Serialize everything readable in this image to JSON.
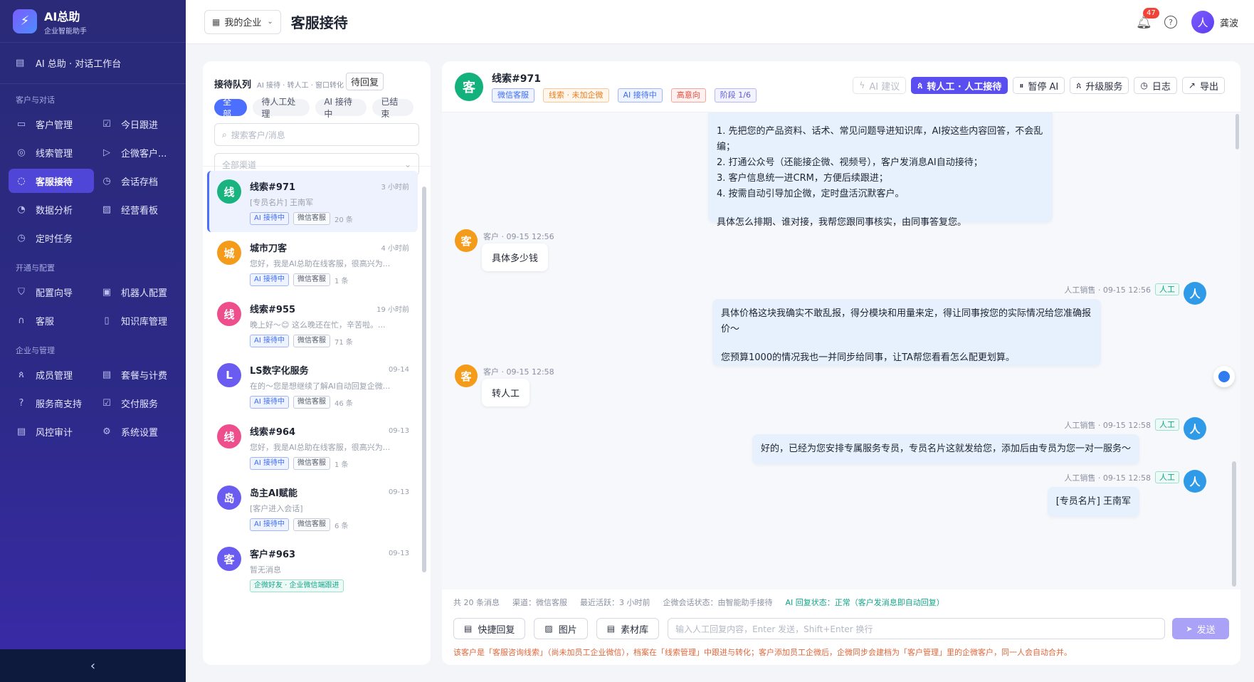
{
  "brand": {
    "name": "AI总助",
    "subtitle": "企业智能助手",
    "logo_icon": "lightning-icon"
  },
  "workbench": {
    "label": "AI 总助 · 对话工作台"
  },
  "nav_sections": [
    {
      "title": "客户与对话",
      "items": [
        {
          "label": "客户管理",
          "icon": "id-card-icon"
        },
        {
          "label": "今日跟进",
          "icon": "checkbox-icon"
        },
        {
          "label": "线索管理",
          "icon": "target-icon"
        },
        {
          "label": "企微客户...",
          "icon": "send-icon"
        },
        {
          "label": "客服接待",
          "icon": "chat-icon",
          "active": true
        },
        {
          "label": "会话存档",
          "icon": "history-icon"
        },
        {
          "label": "数据分析",
          "icon": "gauge-icon"
        },
        {
          "label": "经营看板",
          "icon": "chart-icon"
        },
        {
          "label": "定时任务",
          "icon": "clock-icon"
        }
      ]
    },
    {
      "title": "开通与配置",
      "items": [
        {
          "label": "配置向导",
          "icon": "shield-icon"
        },
        {
          "label": "机器人配置",
          "icon": "robot-icon"
        },
        {
          "label": "客服",
          "icon": "headset-icon"
        },
        {
          "label": "知识库管理",
          "icon": "book-icon"
        }
      ]
    },
    {
      "title": "企业与管理",
      "items": [
        {
          "label": "成员管理",
          "icon": "users-icon"
        },
        {
          "label": "套餐与计费",
          "icon": "package-icon"
        },
        {
          "label": "服务商支持",
          "icon": "help-icon"
        },
        {
          "label": "交付服务",
          "icon": "checkbox-icon"
        },
        {
          "label": "风控审计",
          "icon": "audit-icon"
        },
        {
          "label": "系统设置",
          "icon": "gear-icon"
        }
      ]
    }
  ],
  "topbar": {
    "enterprise": "我的企业",
    "title": "客服接待",
    "notification_count": "47",
    "user_avatar": "人",
    "user_name": "龚波"
  },
  "queue": {
    "title": "接待队列",
    "subtitle": "AI 接待 · 转人工 · 窗口转化",
    "pending_label": "待回复",
    "tabs": [
      "全部",
      "待人工处理",
      "AI 接待中",
      "已结束"
    ],
    "search_placeholder": "搜索客户/消息",
    "channel_placeholder": "全部渠道",
    "items": [
      {
        "avatar": "线",
        "color": "#19b37f",
        "name": "线索#971",
        "time": "3 小时前",
        "preview": "[专员名片] 王南军",
        "tags": [
          {
            "t": "AI 接待中",
            "c": "blue"
          },
          {
            "t": "微信客服",
            "c": "gray"
          }
        ],
        "count": "20 条",
        "active": true
      },
      {
        "avatar": "城",
        "color": "#f49b1a",
        "name": "城市刀客",
        "time": "4 小时前",
        "preview": "您好，我是AI总助在线客服，很高兴为...",
        "tags": [
          {
            "t": "AI 接待中",
            "c": "blue"
          },
          {
            "t": "微信客服",
            "c": "gray"
          }
        ],
        "count": "1 条"
      },
      {
        "avatar": "线",
        "color": "#ee4f8c",
        "name": "线索#955",
        "time": "19 小时前",
        "preview": "晚上好～😊 这么晚还在忙，辛苦啦。...",
        "tags": [
          {
            "t": "AI 接待中",
            "c": "blue"
          },
          {
            "t": "微信客服",
            "c": "gray"
          }
        ],
        "count": "71 条"
      },
      {
        "avatar": "L",
        "color": "#6a5cf0",
        "name": "LS数字化服务",
        "time": "09-14",
        "preview": "在的～您是想继续了解AI自动回复企微...",
        "tags": [
          {
            "t": "AI 接待中",
            "c": "blue"
          },
          {
            "t": "微信客服",
            "c": "gray"
          }
        ],
        "count": "46 条"
      },
      {
        "avatar": "线",
        "color": "#ee4f8c",
        "name": "线索#964",
        "time": "09-13",
        "preview": "您好，我是AI总助在线客服，很高兴为...",
        "tags": [
          {
            "t": "AI 接待中",
            "c": "blue"
          },
          {
            "t": "微信客服",
            "c": "gray"
          }
        ],
        "count": "1 条"
      },
      {
        "avatar": "岛",
        "color": "#6a5cf0",
        "name": "岛主AI赋能",
        "time": "09-13",
        "preview": "[客户进入会话]",
        "tags": [
          {
            "t": "AI 接待中",
            "c": "blue"
          },
          {
            "t": "微信客服",
            "c": "gray"
          }
        ],
        "count": "6 条"
      },
      {
        "avatar": "客",
        "color": "#6a5cf0",
        "name": "客户#963",
        "time": "09-13",
        "preview": "暂无消息",
        "tags": [
          {
            "t": "企微好友 · 企业微信端跟进",
            "c": "green"
          }
        ],
        "count": ""
      }
    ]
  },
  "chat": {
    "avatar": "客",
    "name": "线索#971",
    "tags": [
      {
        "t": "微信客服",
        "c": "blue"
      },
      {
        "t": "线索 · 未加企微",
        "c": "orange"
      },
      {
        "t": "AI 接待中",
        "c": "blue"
      },
      {
        "t": "高意向",
        "c": "red"
      },
      {
        "t": "阶段 1/6",
        "c": "purple"
      }
    ],
    "actions": [
      {
        "label": "AI 建议",
        "icon": "lightning-icon",
        "style": "disabled"
      },
      {
        "label": "转人工 · 人工接待",
        "icon": "user-icon",
        "style": "primary"
      },
      {
        "label": "暂停 AI",
        "icon": "pause-icon",
        "style": ""
      },
      {
        "label": "升级服务",
        "icon": "users-icon",
        "style": ""
      },
      {
        "label": "日志",
        "icon": "history-icon",
        "style": ""
      },
      {
        "label": "导出",
        "icon": "export-icon",
        "style": ""
      }
    ],
    "messages": {
      "m1_lines": [
        "1. 先把您的产品资料、话术、常见问题导进知识库，AI按这些内容回答，不会乱编；",
        "2. 打通公众号（还能接企微、视频号），客户发消息AI自动接待；",
        "3. 客户信息统一进CRM，方便后续跟进；",
        "4. 按需自动引导加企微，定时盘活沉默客户。",
        "",
        "具体怎么排期、谁对接，我帮您跟同事核实，由同事答复您。"
      ],
      "m2_meta": "客户 · 09-15 12:56",
      "m2_text": "具体多少钱",
      "m3_meta": "人工销售 · 09-15 12:56",
      "m3_tag": "人工",
      "m3_line1": "具体价格这块我确实不敢乱报，得分模块和用量来定，得让同事按您的实际情况给您准确报价～",
      "m3_line2": "您预算1000的情况我也一并同步给同事，让TA帮您看看怎么配更划算。",
      "m4_meta": "客户 · 09-15 12:58",
      "m4_text": "转人工",
      "m5_meta": "人工销售 · 09-15 12:58",
      "m5_tag": "人工",
      "m5_text": "好的，已经为您安排专属服务专员，专员名片这就发给您，添加后由专员为您一对一服务～",
      "m6_meta": "人工销售 · 09-15 12:58",
      "m6_tag": "人工",
      "m6_text": "[专员名片] 王南军",
      "customer_avatar": "客",
      "agent_avatar": "人"
    },
    "status": {
      "total": "共 20 条消息",
      "channel": "渠道：微信客服",
      "last_active": "最近活跃：3 小时前",
      "session": "企微会话状态：由智能助手接待",
      "ai_status": "AI 回复状态：正常（客户发消息即自动回复）"
    },
    "tools": [
      {
        "label": "快捷回复",
        "icon": "doc-icon"
      },
      {
        "label": "图片",
        "icon": "image-icon"
      },
      {
        "label": "素材库",
        "icon": "file-icon"
      }
    ],
    "input_placeholder": "输入人工回复内容，Enter 发送，Shift+Enter 换行",
    "send_label": "发送",
    "note": "该客户是「客服咨询线索」（尚未加员工企业微信），档案在「线索管理」中跟进与转化；客户添加员工企微后，企微同步会建档为「客户管理」里的企微客户，同一人会自动合并。"
  }
}
